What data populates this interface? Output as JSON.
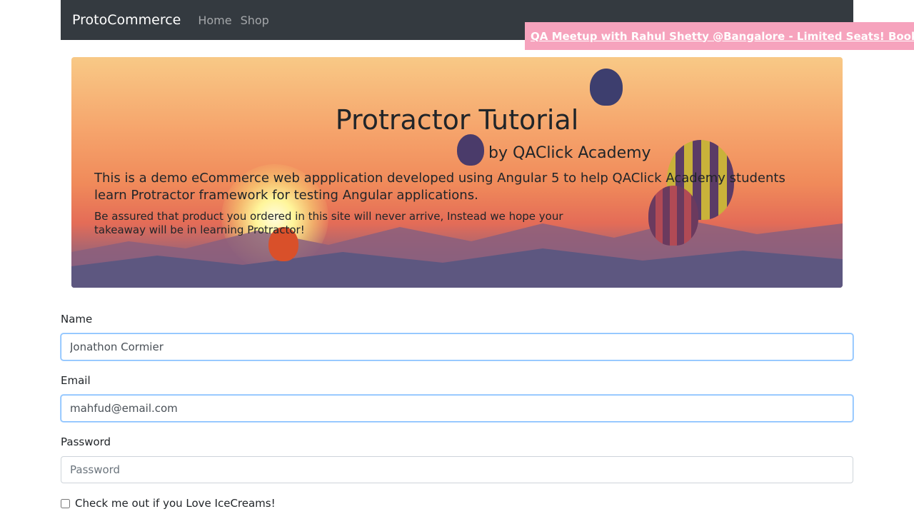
{
  "navbar": {
    "brand": "ProtoCommerce",
    "links": [
      "Home",
      "Shop"
    ]
  },
  "promo": {
    "text": "QA Meetup with Rahul Shetty @Bangalore - Limited Seats! Book Now!"
  },
  "hero": {
    "title": "Protractor Tutorial",
    "subtitle": "by QAClick Academy",
    "lead": "This is a demo eCommerce web appplication developed using Angular 5 to help QAClick Academy students learn Protractor framework for testing Angular applications.",
    "small": "Be assured that product you ordered in this site will never arrive, Instead we hope your takeaway will be in learning Protractor!"
  },
  "form": {
    "name_label": "Name",
    "name_value": "Jonathon Cormier",
    "email_label": "Email",
    "email_value": "mahfud@email.com",
    "password_label": "Password",
    "password_placeholder": "Password",
    "checkbox_label": "Check me out if you Love IceCreams!"
  },
  "colors": {
    "navbar_bg": "#343a40",
    "promo_bg": "#f6a3bd",
    "focus_border": "#80bdff"
  }
}
